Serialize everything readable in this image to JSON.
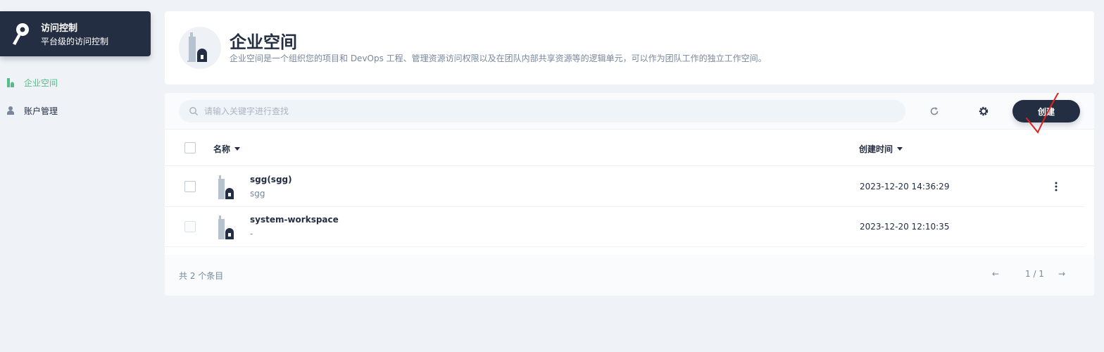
{
  "sidebar": {
    "title": "访问控制",
    "subtitle": "平台级的访问控制",
    "items": [
      {
        "label": "企业空间",
        "active": true,
        "icon": "workspace-icon"
      },
      {
        "label": "账户管理",
        "active": false,
        "icon": "user-icon"
      }
    ]
  },
  "header": {
    "title": "企业空间",
    "description": "企业空间是一个组织您的项目和 DevOps 工程、管理资源访问权限以及在团队内部共享资源等的逻辑单元，可以作为团队工作的独立工作空间。",
    "icon": "workspace-icon"
  },
  "toolbar": {
    "search_placeholder": "请输入关键字进行查找",
    "create_label": "创建",
    "refresh_icon": "refresh-icon",
    "settings_icon": "gear-icon"
  },
  "table": {
    "columns": {
      "name": "名称",
      "created": "创建时间"
    },
    "rows": [
      {
        "name": "sgg(sgg)",
        "desc": "sgg",
        "created": "2023-12-20 14:36:29",
        "selectable": true,
        "has_menu": true
      },
      {
        "name": "system-workspace",
        "desc": "-",
        "created": "2023-12-20 12:10:35",
        "selectable": false,
        "has_menu": false
      }
    ]
  },
  "footer": {
    "count": "共 2 个条目",
    "page": "1 / 1",
    "prev": "←",
    "next": "→"
  },
  "colors": {
    "sidebar_bg": "#242e42",
    "active": "#55bc8a",
    "page_bg": "#eff3f7",
    "annotation": "#e0211f"
  }
}
